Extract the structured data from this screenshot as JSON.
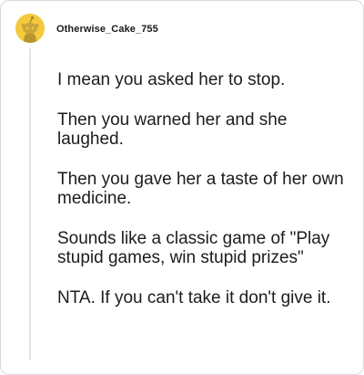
{
  "comment": {
    "author": "Otherwise_Cake_755",
    "avatar_icon": "snoo-avatar-icon",
    "avatar_color": "#f4c93e",
    "paragraphs": [
      "I mean you asked her to stop.",
      "Then you warned her and she laughed.",
      "Then you gave her a taste of her own medicine.",
      "Sounds like a classic game of \"Play stupid games, win stupid prizes\"",
      "NTA. If you can't take it don't give it."
    ]
  }
}
